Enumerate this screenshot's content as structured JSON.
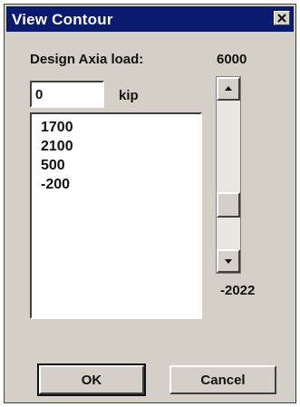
{
  "window": {
    "title": "View Contour",
    "close_symbol": "×"
  },
  "form": {
    "design_label": "Design Axia load:",
    "load_value": "0",
    "unit_label": "kip"
  },
  "list": {
    "items": [
      "1700",
      "2100",
      "500",
      "-200"
    ]
  },
  "scroll": {
    "max_label": "6000",
    "min_label": "-2022",
    "up_icon": "scroll-up-arrow-icon",
    "down_icon": "scroll-down-arrow-icon"
  },
  "buttons": {
    "ok_label": "OK",
    "cancel_label": "Cancel"
  },
  "colors": {
    "titlebar": "#0a1a6e",
    "dialog_face": "#d4d0c8"
  }
}
